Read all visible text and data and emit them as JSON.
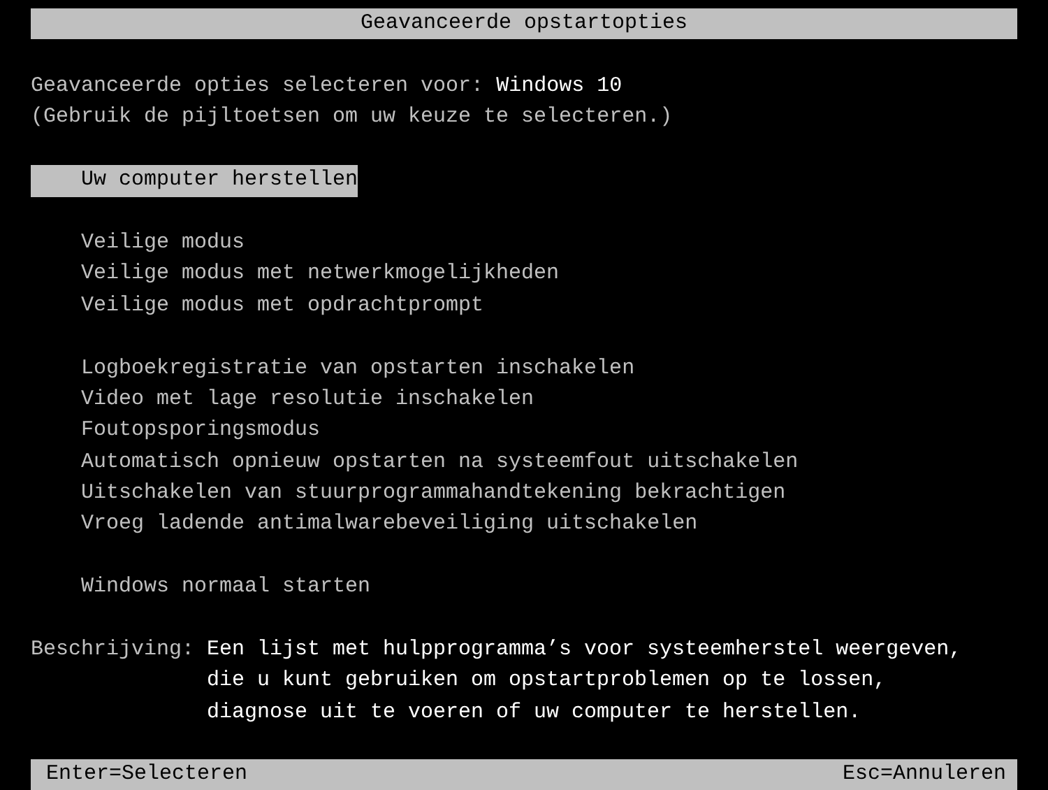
{
  "title": "Geavanceerde opstartopties",
  "prompt": {
    "label": "Geavanceerde opties selecteren voor: ",
    "os": "Windows 10"
  },
  "instruction": "(Gebruik de pijltoetsen om uw keuze te selecteren.)",
  "menu_groups": [
    {
      "items": [
        {
          "label": "Uw computer herstellen",
          "selected": true
        }
      ]
    },
    {
      "items": [
        {
          "label": "Veilige modus",
          "selected": false
        },
        {
          "label": "Veilige modus met netwerkmogelijkheden",
          "selected": false
        },
        {
          "label": "Veilige modus met opdrachtprompt",
          "selected": false
        }
      ]
    },
    {
      "items": [
        {
          "label": "Logboekregistratie van opstarten inschakelen",
          "selected": false
        },
        {
          "label": "Video met lage resolutie inschakelen",
          "selected": false
        },
        {
          "label": "Foutopsporingsmodus",
          "selected": false
        },
        {
          "label": "Automatisch opnieuw opstarten na systeemfout uitschakelen",
          "selected": false
        },
        {
          "label": "Uitschakelen van stuurprogrammahandtekening bekrachtigen",
          "selected": false
        },
        {
          "label": "Vroeg ladende antimalwarebeveiliging uitschakelen",
          "selected": false
        }
      ]
    },
    {
      "items": [
        {
          "label": "Windows normaal starten",
          "selected": false
        }
      ]
    }
  ],
  "description": {
    "label": "Beschrijving:",
    "lines": [
      "Een lijst met hulpprogramma’s voor systeemherstel weergeven,",
      "die u kunt gebruiken om opstartproblemen op te lossen,",
      "diagnose uit te voeren of uw computer te herstellen."
    ]
  },
  "status_bar": {
    "left": "Enter=Selecteren",
    "right": "Esc=Annuleren"
  }
}
